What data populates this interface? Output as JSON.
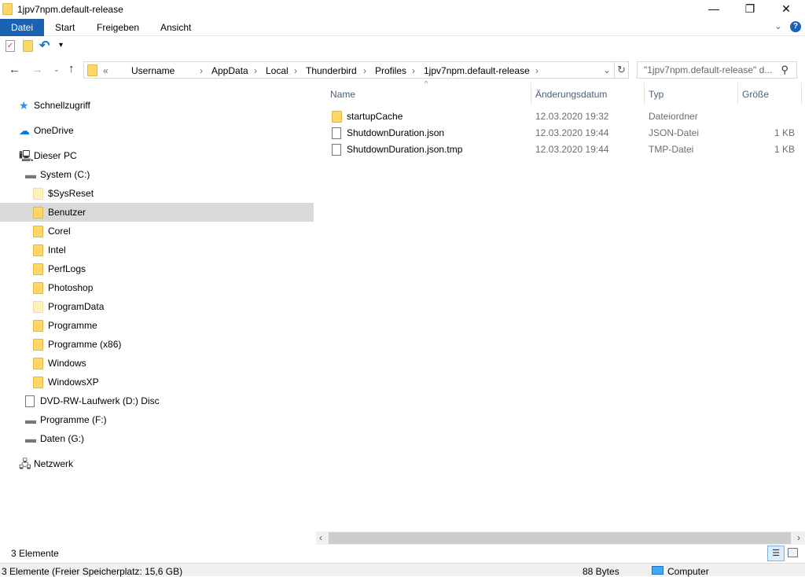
{
  "window": {
    "title": "1jpv7npm.default-release",
    "minimize": "—",
    "maximize": "❐",
    "close": "✕"
  },
  "ribbon": {
    "tabs": [
      "Datei",
      "Start",
      "Freigeben",
      "Ansicht"
    ],
    "expand": "⌄",
    "help": "?"
  },
  "address": {
    "overflow": "«",
    "crumbs": [
      "Username",
      "AppData",
      "Local",
      "Thunderbird",
      "Profiles",
      "1jpv7npm.default-release"
    ],
    "sep": "›"
  },
  "search": {
    "placeholder": "\"1jpv7npm.default-release\" d..."
  },
  "nav": [
    {
      "label": "Schnellzugriff",
      "icon": "star",
      "level": 0
    },
    {
      "label": "OneDrive",
      "icon": "cloud",
      "level": 0
    },
    {
      "label": "Dieser PC",
      "icon": "pc",
      "level": 0
    },
    {
      "label": "System (C:)",
      "icon": "drive-win",
      "level": 1
    },
    {
      "label": "$SysReset",
      "icon": "folder-pale",
      "level": 2
    },
    {
      "label": "Benutzer",
      "icon": "folder",
      "level": 2,
      "selected": true
    },
    {
      "label": "Corel",
      "icon": "folder",
      "level": 2
    },
    {
      "label": "Intel",
      "icon": "folder",
      "level": 2
    },
    {
      "label": "PerfLogs",
      "icon": "folder",
      "level": 2
    },
    {
      "label": "Photoshop",
      "icon": "folder",
      "level": 2
    },
    {
      "label": "ProgramData",
      "icon": "folder-pale",
      "level": 2
    },
    {
      "label": "Programme",
      "icon": "folder",
      "level": 2
    },
    {
      "label": "Programme (x86)",
      "icon": "folder",
      "level": 2
    },
    {
      "label": "Windows",
      "icon": "folder",
      "level": 2
    },
    {
      "label": "WindowsXP",
      "icon": "folder",
      "level": 2
    },
    {
      "label": "DVD-RW-Laufwerk (D:) Disc",
      "icon": "disc",
      "level": 1
    },
    {
      "label": "Programme (F:)",
      "icon": "drive",
      "level": 1
    },
    {
      "label": "Daten (G:)",
      "icon": "drive",
      "level": 1
    },
    {
      "label": "Netzwerk",
      "icon": "network",
      "level": 0
    }
  ],
  "columns": {
    "name": "Name",
    "date": "Änderungsdatum",
    "type": "Typ",
    "size": "Größe"
  },
  "files": [
    {
      "name": "startupCache",
      "date": "12.03.2020 19:32",
      "type": "Dateiordner",
      "size": "",
      "icon": "folder"
    },
    {
      "name": "ShutdownDuration.json",
      "date": "12.03.2020 19:44",
      "type": "JSON-Datei",
      "size": "1 KB",
      "icon": "file"
    },
    {
      "name": "ShutdownDuration.json.tmp",
      "date": "12.03.2020 19:44",
      "type": "TMP-Datei",
      "size": "1 KB",
      "icon": "file"
    }
  ],
  "status": {
    "count": "3 Elemente",
    "details": "3 Elemente (Freier Speicherplatz: 15,6 GB)",
    "bytes": "88 Bytes",
    "location": "Computer"
  }
}
